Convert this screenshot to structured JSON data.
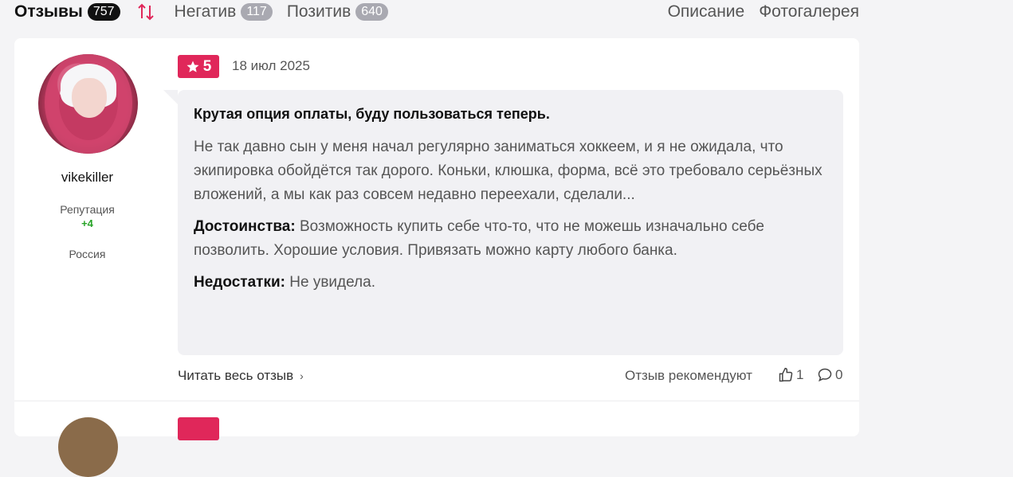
{
  "tabs": [
    {
      "label": "Отзывы",
      "count": "757"
    },
    {
      "label": "Негатив",
      "count": "117"
    },
    {
      "label": "Позитив",
      "count": "640"
    }
  ],
  "nav": {
    "description": "Описание",
    "gallery": "Фотогалерея"
  },
  "review": {
    "author": "vikekiller",
    "reputation_label": "Репутация",
    "reputation_value": "+4",
    "country": "Россия",
    "rating": "5",
    "date": "18 июл 2025",
    "title": "Крутая опция оплаты, буду пользоваться теперь.",
    "body": "Не так давно сын у меня начал регулярно заниматься хоккеем, и я не ожидала, что экипировка обойдётся так дорого. Коньки, клюшка, форма, всё это требовало серьёзных вложений, а мы как раз совсем недавно переехали, сделали...",
    "pros_label": "Достоинства:",
    "pros": "Возможность купить себе что-то, что не можешь изначально себе позволить. Хорошие условия. Привязать можно карту любого банка.",
    "cons_label": "Недостатки:",
    "cons": "Не увидела.",
    "read_more": "Читать весь отзыв",
    "recommend_label": "Отзыв рекомендуют",
    "likes": "1",
    "comments": "0"
  },
  "colors": {
    "accent": "#e0275a",
    "reputation": "#27a327"
  }
}
